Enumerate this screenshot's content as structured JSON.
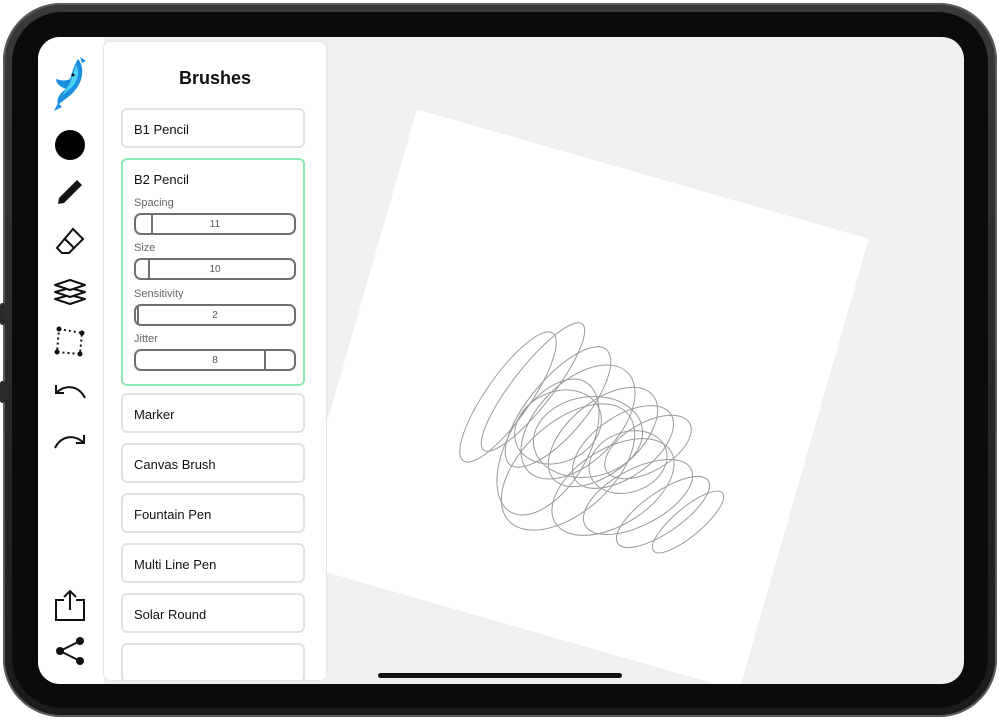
{
  "panel": {
    "title": "Brushes",
    "brushes": [
      {
        "name": "B1 Pencil"
      },
      {
        "name": "B2 Pencil",
        "active": true
      },
      {
        "name": "Marker"
      },
      {
        "name": "Canvas Brush"
      },
      {
        "name": "Fountain Pen"
      },
      {
        "name": "Multi Line Pen"
      },
      {
        "name": "Solar Round"
      }
    ],
    "active_brush": {
      "params": [
        {
          "label": "Spacing",
          "value": "11"
        },
        {
          "label": "Size",
          "value": "10"
        },
        {
          "label": "Sensitivity",
          "value": "2"
        },
        {
          "label": "Jitter",
          "value": "8"
        }
      ]
    }
  },
  "toolbar": {
    "tools": [
      "dolphin-logo",
      "color-swatch",
      "pencil-icon",
      "eraser-icon",
      "layers-icon",
      "selection-icon",
      "undo-icon",
      "redo-icon"
    ],
    "bottom_tools": [
      "export-icon",
      "share-icon"
    ],
    "current_color": "#000000"
  },
  "colors": {
    "accent": "#8fe9b4",
    "canvas_bg": "#f0f0f0",
    "stroke": "#9a9a9a"
  }
}
